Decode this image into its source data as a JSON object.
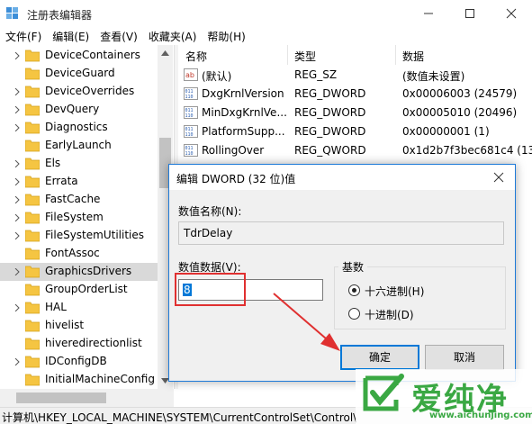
{
  "window": {
    "title": "注册表编辑器"
  },
  "menu": [
    "文件(F)",
    "编辑(E)",
    "查看(V)",
    "收藏夹(A)",
    "帮助(H)"
  ],
  "tree": {
    "items": [
      {
        "label": "DeviceContainers",
        "expandable": true,
        "selected": false
      },
      {
        "label": "DeviceGuard",
        "expandable": false,
        "selected": false
      },
      {
        "label": "DeviceOverrides",
        "expandable": true,
        "selected": false
      },
      {
        "label": "DevQuery",
        "expandable": true,
        "selected": false
      },
      {
        "label": "Diagnostics",
        "expandable": true,
        "selected": false
      },
      {
        "label": "EarlyLaunch",
        "expandable": false,
        "selected": false
      },
      {
        "label": "Els",
        "expandable": true,
        "selected": false
      },
      {
        "label": "Errata",
        "expandable": true,
        "selected": false
      },
      {
        "label": "FastCache",
        "expandable": true,
        "selected": false
      },
      {
        "label": "FileSystem",
        "expandable": true,
        "selected": false
      },
      {
        "label": "FileSystemUtilities",
        "expandable": true,
        "selected": false
      },
      {
        "label": "FontAssoc",
        "expandable": false,
        "selected": false
      },
      {
        "label": "GraphicsDrivers",
        "expandable": true,
        "selected": true
      },
      {
        "label": "GroupOrderList",
        "expandable": false,
        "selected": false
      },
      {
        "label": "HAL",
        "expandable": true,
        "selected": false
      },
      {
        "label": "hivelist",
        "expandable": false,
        "selected": false
      },
      {
        "label": "hiveredirectionlist",
        "expandable": false,
        "selected": false
      },
      {
        "label": "IDConfigDB",
        "expandable": true,
        "selected": false
      },
      {
        "label": "InitialMachineConfig",
        "expandable": false,
        "selected": false
      }
    ]
  },
  "list": {
    "headers": {
      "name": "名称",
      "type": "类型",
      "data": "数据"
    },
    "rows": [
      {
        "icon": "string-value-icon",
        "name": "(默认)",
        "type": "REG_SZ",
        "data": "(数值未设置)"
      },
      {
        "icon": "binary-value-icon",
        "name": "DxgKrnlVersion",
        "type": "REG_DWORD",
        "data": "0x00006003 (24579)"
      },
      {
        "icon": "binary-value-icon",
        "name": "MinDxgKrnlVe...",
        "type": "REG_DWORD",
        "data": "0x00005010 (20496)"
      },
      {
        "icon": "binary-value-icon",
        "name": "PlatformSupp...",
        "type": "REG_DWORD",
        "data": "0x00000001 (1)"
      },
      {
        "icon": "binary-value-icon",
        "name": "RollingOver",
        "type": "REG_QWORD",
        "data": "0x1d2b7f3bec681c4 (131"
      }
    ]
  },
  "status": {
    "path": "计算机\\HKEY_LOCAL_MACHINE\\SYSTEM\\CurrentControlSet\\Control\\"
  },
  "dialog": {
    "title": "编辑 DWORD (32 位)值",
    "name_label": "数值名称(N):",
    "name_value": "TdrDelay",
    "data_label": "数值数据(V):",
    "data_value": "8",
    "base_label": "基数",
    "radio_hex": "十六进制(H)",
    "radio_dec": "十进制(D)",
    "base_selected": "hex",
    "ok_label": "确定",
    "cancel_label": "取消"
  },
  "watermark": {
    "brand": "爱纯净",
    "url": "www.aichunjing.com"
  },
  "colors": {
    "accent": "#0078d7",
    "annotation_red": "#e03030",
    "folder": "#f5c542",
    "watermark_green": "#3aa843"
  }
}
